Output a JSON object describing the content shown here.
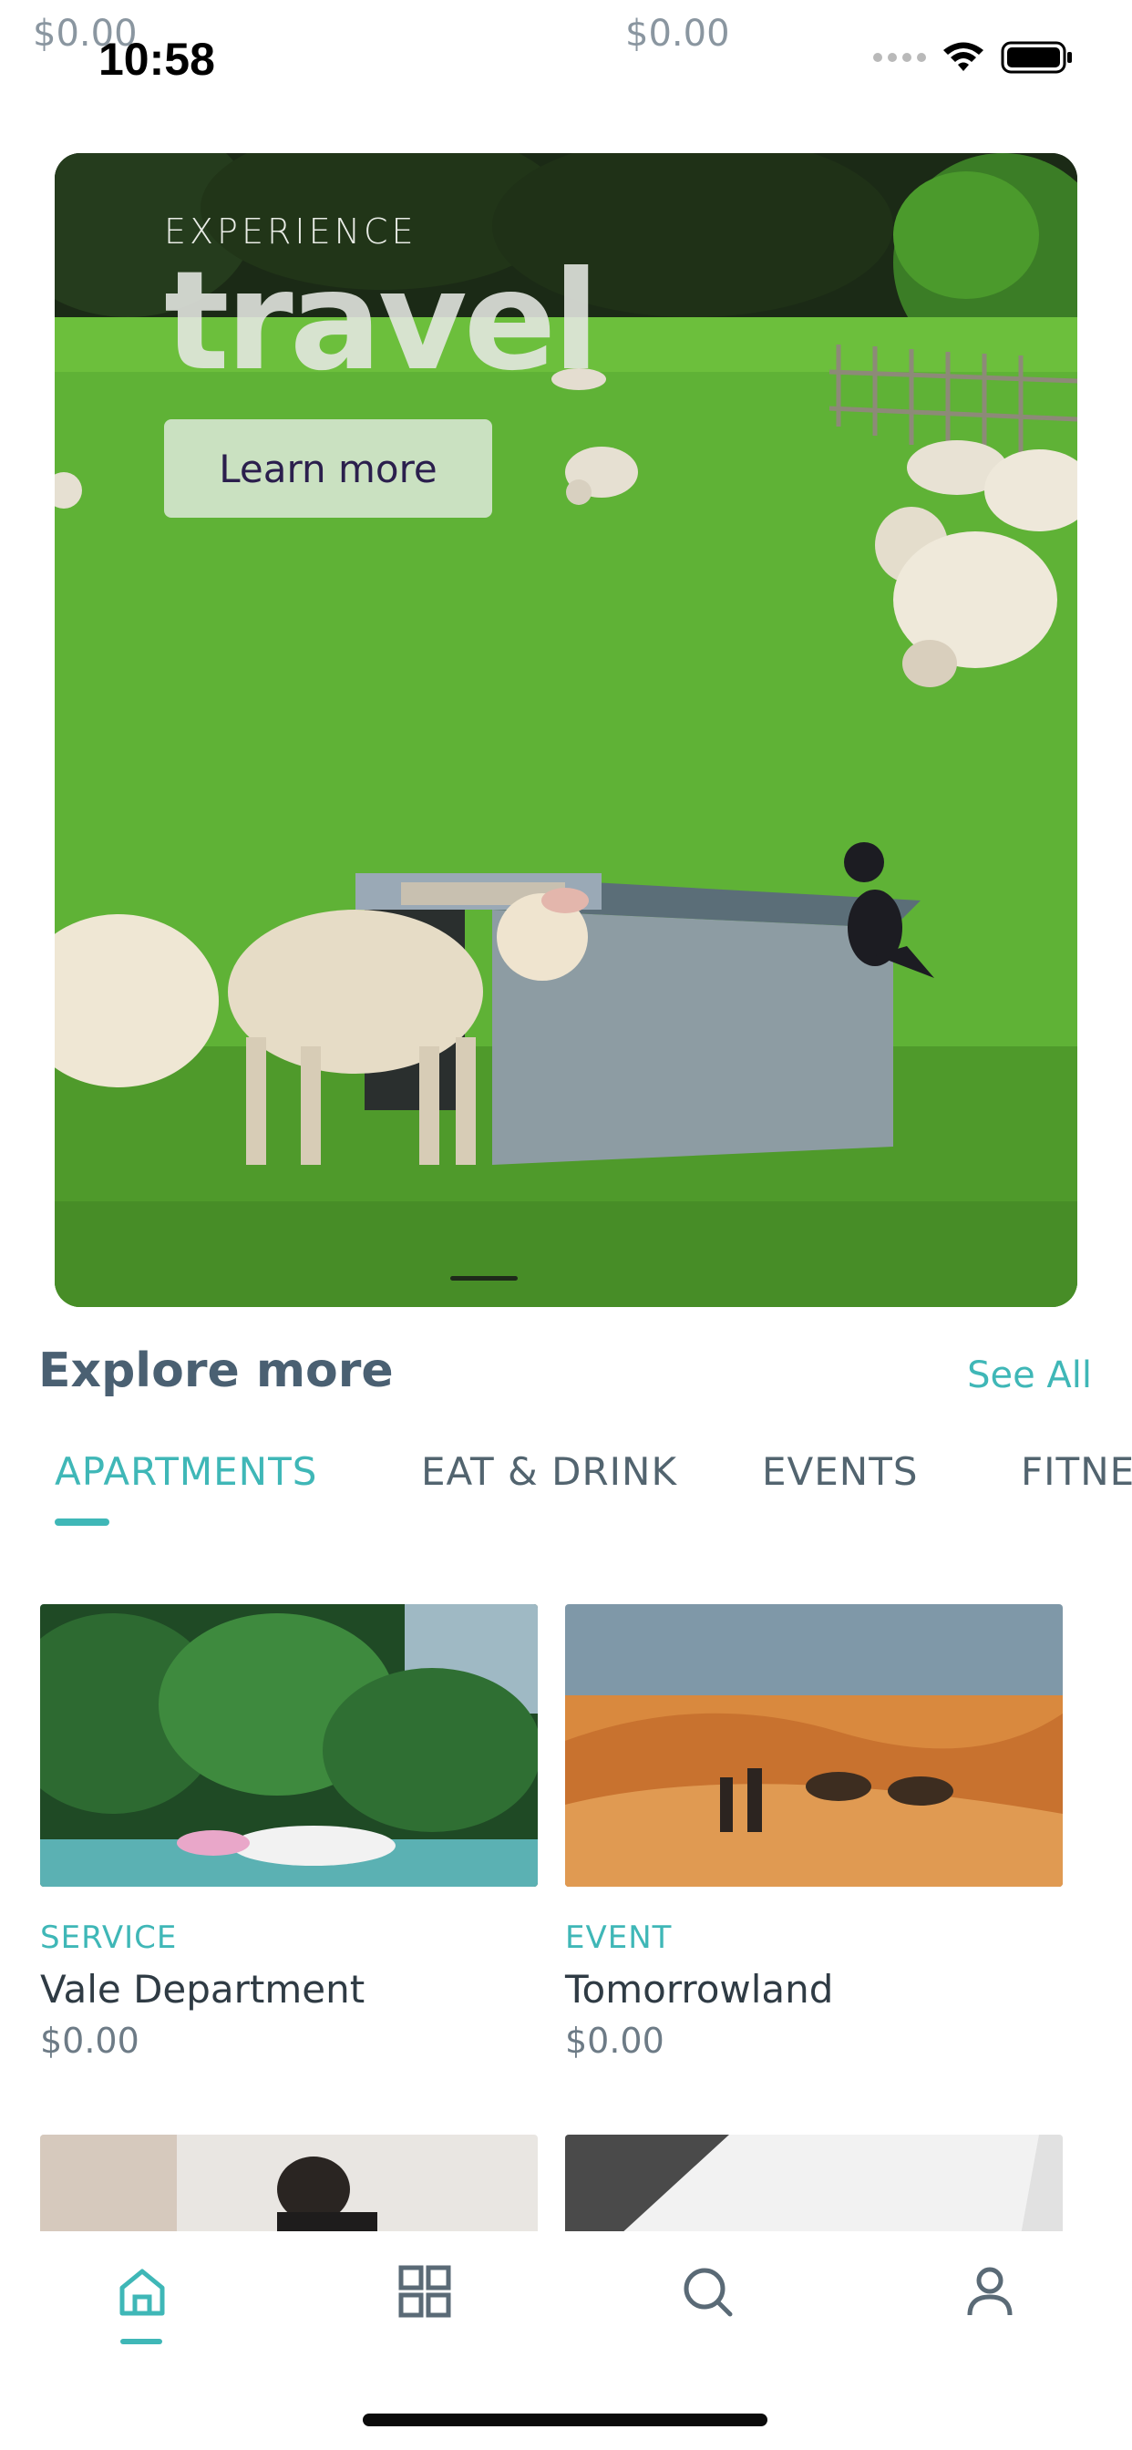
{
  "status_bar": {
    "time": "10:58",
    "ghost_price_left": "$0.00",
    "ghost_price_right": "$0.00",
    "icons": [
      "signal-icon",
      "wifi-icon",
      "battery-icon"
    ]
  },
  "hero": {
    "kicker": "EXPERIENCE",
    "title": "travel",
    "button_label": "Learn more"
  },
  "explore": {
    "title": "Explore more",
    "see_all": "See All"
  },
  "tabs": [
    {
      "label": "APARTMENTS",
      "active": true
    },
    {
      "label": "EAT & DRINK",
      "active": false
    },
    {
      "label": "EVENTS",
      "active": false
    },
    {
      "label": "FITNE",
      "active": false
    }
  ],
  "cards": [
    {
      "category": "SERVICE",
      "name": "Vale Department",
      "price": "$0.00"
    },
    {
      "category": "EVENT",
      "name": "Tomorrowland",
      "price": "$0.00"
    }
  ],
  "bottom_nav": [
    {
      "icon": "home-icon",
      "active": true
    },
    {
      "icon": "grid-icon",
      "active": false
    },
    {
      "icon": "search-icon",
      "active": false
    },
    {
      "icon": "profile-icon",
      "active": false
    }
  ],
  "colors": {
    "accent": "#3fb7b7",
    "heading": "#4a6072",
    "text": "#2f3b44"
  }
}
